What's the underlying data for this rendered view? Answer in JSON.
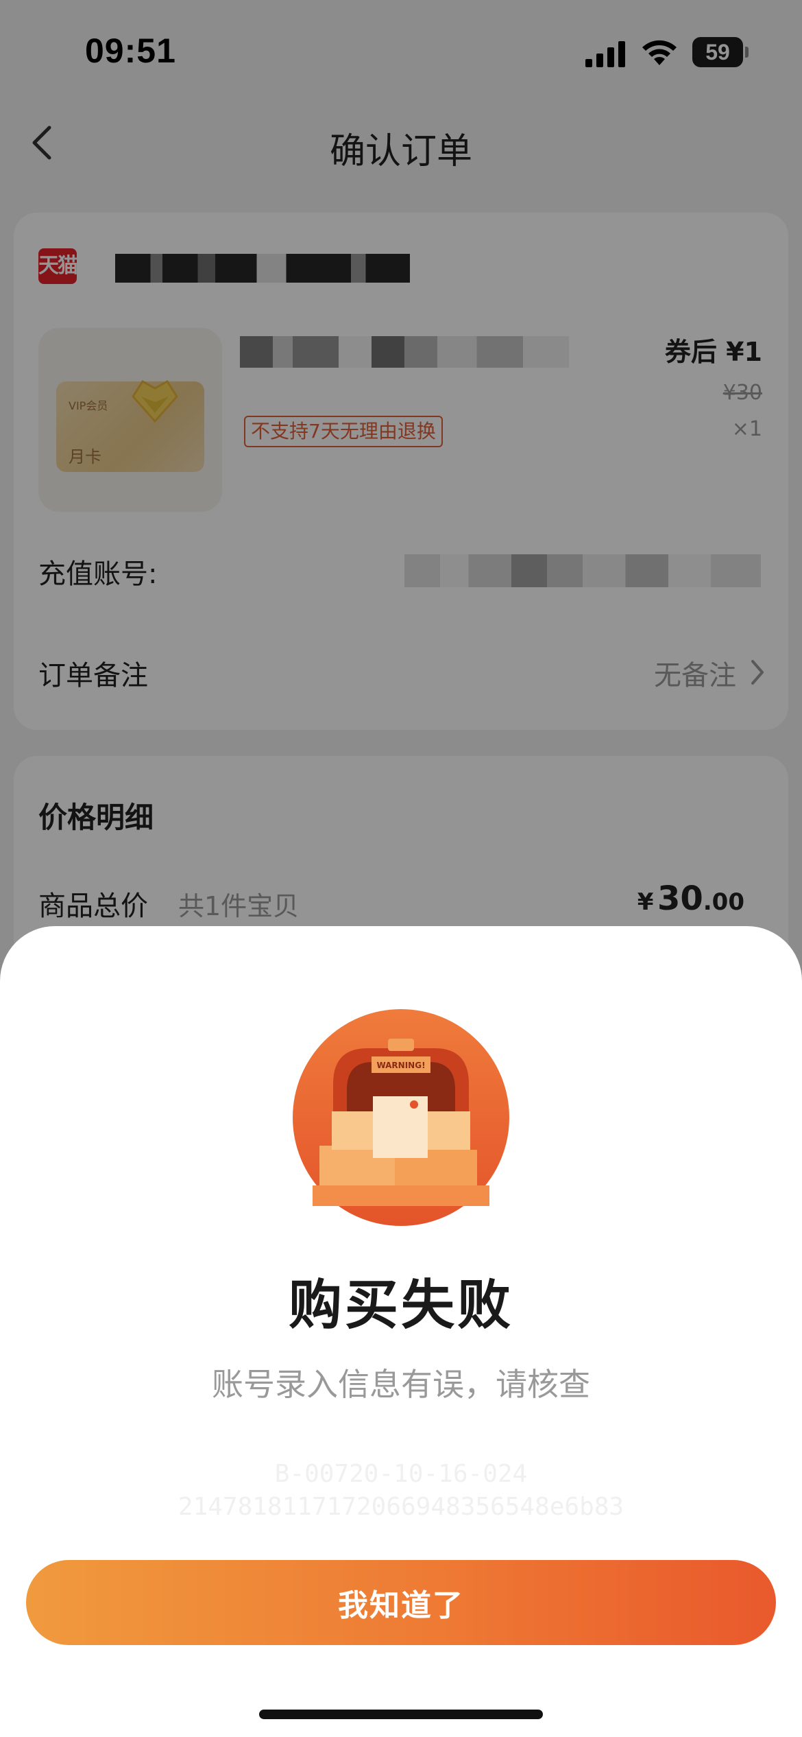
{
  "status_bar": {
    "time": "09:51",
    "battery_level": "59",
    "icons": [
      "signal-icon",
      "wifi-icon",
      "battery-icon"
    ]
  },
  "nav": {
    "title": "确认订单",
    "back_icon": "chevron-left-icon"
  },
  "order": {
    "shop_logo_text": "天猫",
    "product": {
      "card_label": "VIP会员",
      "card_sub_label": "月卡",
      "after_coupon_price": "券后 ¥1",
      "original_price": "¥30",
      "quantity": "×1",
      "tag": "不支持7天无理由退换"
    },
    "account_label": "充值账号:",
    "remark_label": "订单备注",
    "remark_value": "无备注"
  },
  "price_detail": {
    "title": "价格明细",
    "goods_total_label": "商品总价",
    "goods_count": "共1件宝贝",
    "goods_total_currency": "¥",
    "goods_total_int": "30",
    "goods_total_dec": ".00"
  },
  "dialog": {
    "illustration_label": "WARNING!",
    "title": "购买失败",
    "message": "账号录入信息有误，请核查",
    "code_line_1": "B-00720-10-16-024",
    "code_line_2": "2147818117172066948356548e6b83",
    "button_label": "我知道了"
  },
  "colors": {
    "accent_start": "#f09a3e",
    "accent_end": "#e9592c",
    "brand_red": "#e5232b",
    "tag_orange": "#e0603a"
  }
}
